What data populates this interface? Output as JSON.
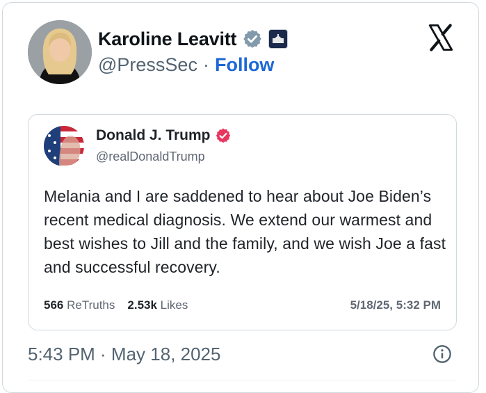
{
  "author": {
    "name": "Karoline Leavitt",
    "handle": "@PressSec",
    "separator": "·",
    "follow_label": "Follow",
    "verified_badge_color": "#829aab",
    "affiliate_badge": "white-house-badge-icon"
  },
  "platform_icon": "x-logo-icon",
  "quoted_post": {
    "name": "Donald J. Trump",
    "handle": "@realDonaldTrump",
    "verified_badge_color": "#e8375e",
    "text": "Melania and I are saddened to hear about Joe Biden’s recent medical diagnosis. We extend our warmest and best wishes to Jill and the family, and we wish Joe a fast and successful recovery.",
    "retruths_count": "566",
    "retruths_label": "ReTruths",
    "likes_count": "2.53k",
    "likes_label": "Likes",
    "posted_at": "5/18/25, 5:32 PM"
  },
  "timestamp": "5:43 PM · May 18, 2025",
  "colors": {
    "follow": "#1d67d6",
    "secondary_text": "#536471",
    "border": "#cfd9de"
  }
}
